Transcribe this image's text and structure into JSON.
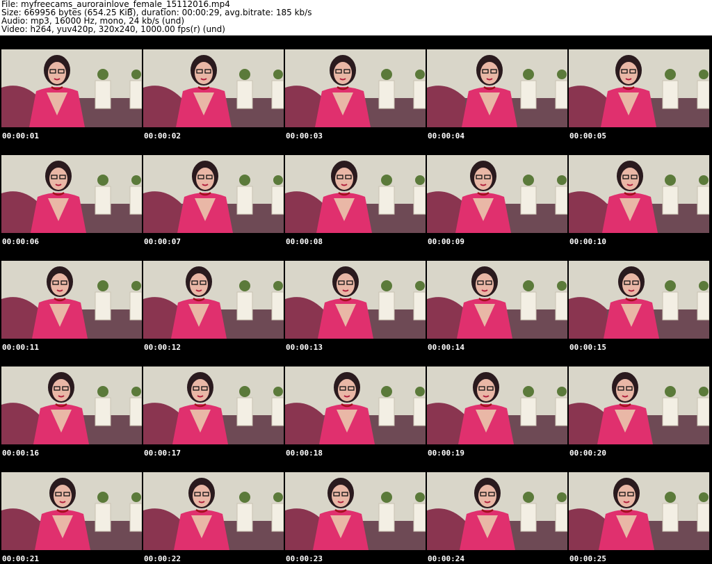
{
  "header": {
    "file_line": "File: myfreecams_aurorainlove_female_15112016.mp4",
    "size_line": "Size: 669956 bytes (654.25 KiB), duration: 00:00:29, avg.bitrate: 185 kb/s",
    "audio_line": "Audio: mp3, 16000 Hz, mono, 24 kb/s (und)",
    "video_line": "Video: h264, yuv420p, 320x240, 1000.00 fps(r) (und)"
  },
  "thumbnails": [
    {
      "timestamp": "00:00:01"
    },
    {
      "timestamp": "00:00:02"
    },
    {
      "timestamp": "00:00:03"
    },
    {
      "timestamp": "00:00:04"
    },
    {
      "timestamp": "00:00:05"
    },
    {
      "timestamp": "00:00:06"
    },
    {
      "timestamp": "00:00:07"
    },
    {
      "timestamp": "00:00:08"
    },
    {
      "timestamp": "00:00:09"
    },
    {
      "timestamp": "00:00:10"
    },
    {
      "timestamp": "00:00:11"
    },
    {
      "timestamp": "00:00:12"
    },
    {
      "timestamp": "00:00:13"
    },
    {
      "timestamp": "00:00:14"
    },
    {
      "timestamp": "00:00:15"
    },
    {
      "timestamp": "00:00:16"
    },
    {
      "timestamp": "00:00:17"
    },
    {
      "timestamp": "00:00:18"
    },
    {
      "timestamp": "00:00:19"
    },
    {
      "timestamp": "00:00:20"
    },
    {
      "timestamp": "00:00:21"
    },
    {
      "timestamp": "00:00:22"
    },
    {
      "timestamp": "00:00:23"
    },
    {
      "timestamp": "00:00:24"
    },
    {
      "timestamp": "00:00:25"
    }
  ],
  "colors": {
    "background": "#000000",
    "timestamp_text": "#ffffff",
    "header_text": "#000000",
    "wall": "#d9d6c9",
    "sofa": "#8a3550",
    "dress": "#e0306e",
    "hair": "#2a1a1e",
    "skin": "#e9b7a6"
  }
}
